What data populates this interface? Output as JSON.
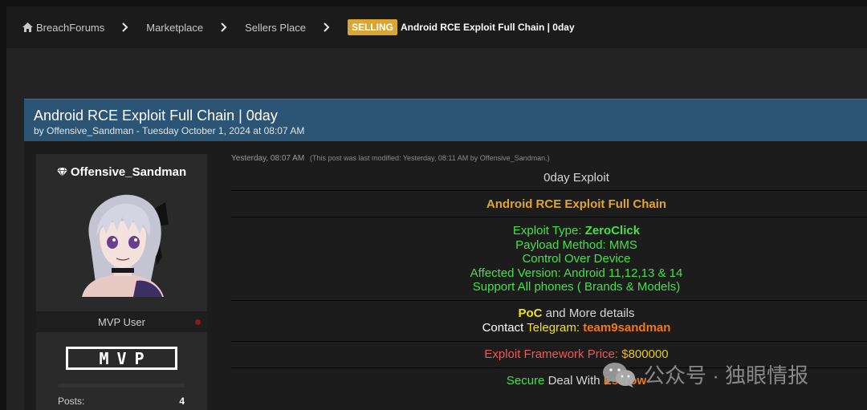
{
  "breadcrumb": {
    "home": "BreachForums",
    "items": [
      "Marketplace",
      "Sellers Place"
    ],
    "badge": "SELLING",
    "current": "Android RCE Exploit Full Chain | 0day"
  },
  "thread": {
    "title": "Android RCE Exploit Full Chain | 0day",
    "meta": "by Offensive_Sandman - Tuesday October 1, 2024 at 08:07 AM"
  },
  "user": {
    "name": "Offensive_Sandman",
    "rank": "MVP User",
    "badge": "MVP",
    "posts_label": "Posts:",
    "posts_value": "4"
  },
  "post": {
    "time": "Yesterday, 08:07 AM",
    "modified": "(This post was last modified: Yesterday, 08:11 AM by Offensive_Sandman.)",
    "heading": "0day Exploit",
    "subheading": "Android RCE Exploit Full Chain",
    "exploit_type_label": "Exploit Type: ",
    "exploit_type_value": "ZeroClick",
    "payload": "Payload Method: MMS",
    "control": "Control Over Device",
    "affected": "Affected Version: Android 11,12,13 & 14",
    "support": "Support All phones ( Brands & Models)",
    "poc": "PoC",
    "poc_rest": " and More details",
    "contact": "Contact ",
    "telegram_label": "Telegram: ",
    "telegram_handle": "team9sandman",
    "price_label": "Exploit Framework Price: ",
    "price_currency": "$",
    "price_value": "800000",
    "deal_prefix": "Secure",
    "deal_mid": " Deal With ",
    "deal_suffix": "Escrow"
  },
  "watermark": "公众号 · 独眼情报",
  "colors": {
    "header_blue": "#2c5475",
    "accent_gold": "#d9a633",
    "text_green": "#46e046",
    "text_orange": "#f07818"
  }
}
